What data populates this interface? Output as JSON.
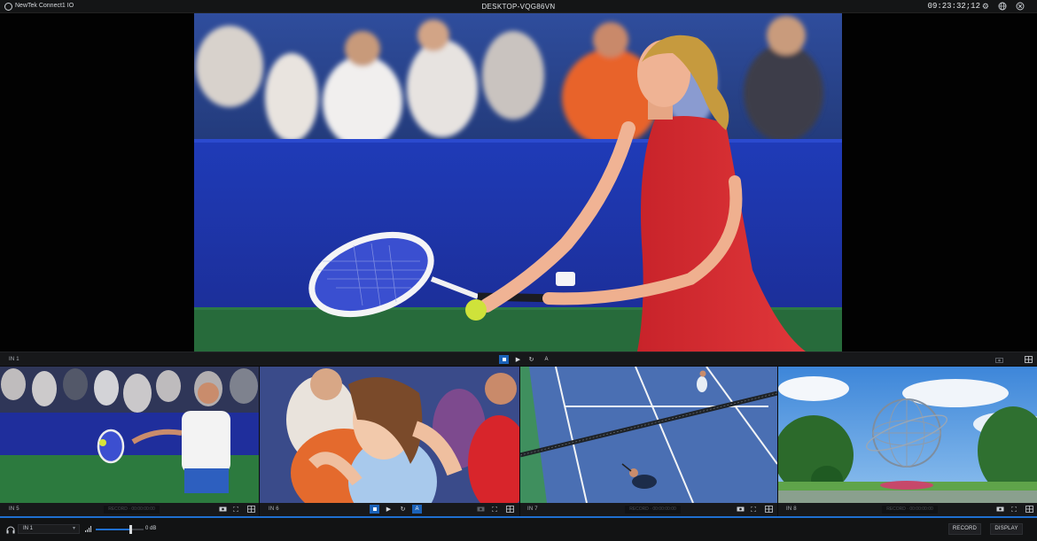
{
  "titlebar": {
    "app_name": "NewTek Connect1 IO",
    "host_name": "DESKTOP-VQG86VN",
    "timecode": "09:23:32;12",
    "icons": [
      "newtek-logo-icon",
      "gear-icon",
      "globe-icon",
      "close-icon"
    ]
  },
  "main_monitor": {
    "input_label": "IN 1",
    "controls": {
      "stop": "■",
      "play": "▶",
      "loop": "↻",
      "audio_label": "A"
    },
    "icons": [
      "camera-icon",
      "layout-icon"
    ]
  },
  "inputs": [
    {
      "label": "IN 5",
      "record_text": "RECORD · 00:00:00:00"
    },
    {
      "label": "IN 6",
      "audio_label": "A"
    },
    {
      "label": "IN 7",
      "record_text": "RECORD · 00:00:00:00"
    },
    {
      "label": "IN 8",
      "record_text": "RECORD · 00:00:00:00"
    }
  ],
  "footer": {
    "monitor_source": "IN 1",
    "volume_db": "0 dB",
    "volume_level": 0.72,
    "record_button": "RECORD",
    "display_button": "DISPLAY"
  },
  "colors": {
    "accent": "#1f6fd0",
    "panel": "#17181a",
    "background": "#0b0b0c"
  }
}
